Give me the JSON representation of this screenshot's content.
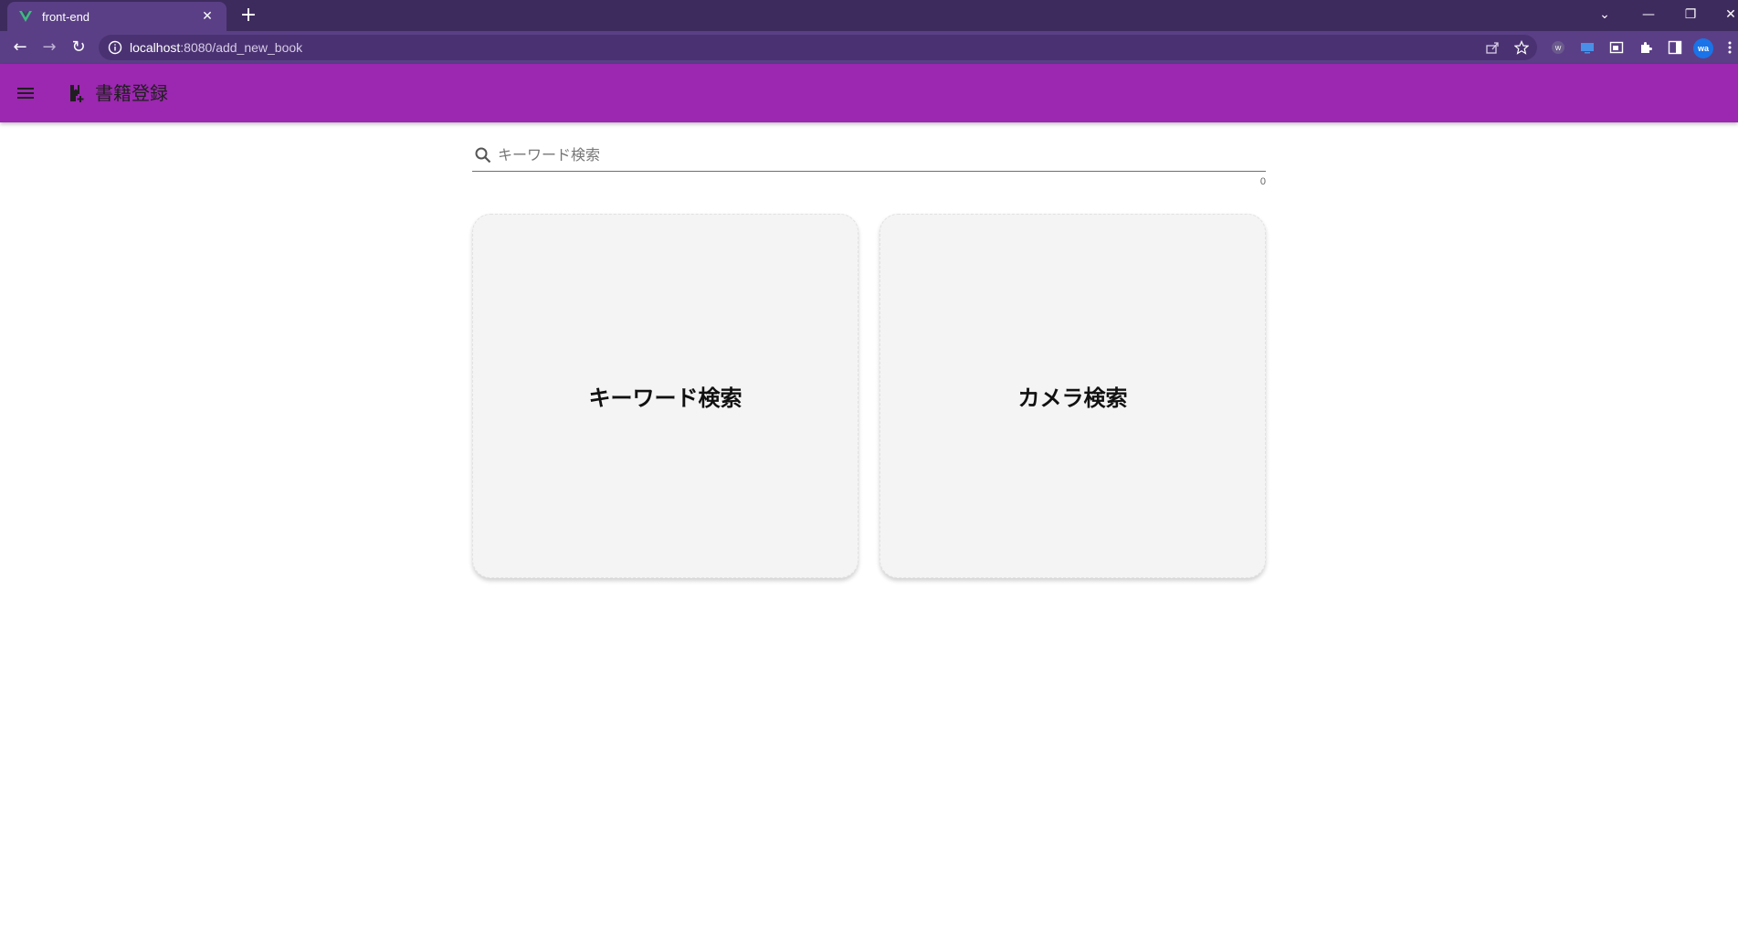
{
  "browser": {
    "tab_title": "front-end",
    "url_host": "localhost",
    "url_path": ":8080/add_new_book",
    "profile_initials": "wa",
    "accent": "#9c27b0"
  },
  "appbar": {
    "menu_icon": "hamburger-menu-icon",
    "title_icon": "book-add-icon",
    "title": "書籍登録"
  },
  "search": {
    "placeholder": "キーワード検索",
    "value": "",
    "counter": "0"
  },
  "cards": [
    {
      "label": "キーワード検索"
    },
    {
      "label": "カメラ検索"
    }
  ]
}
